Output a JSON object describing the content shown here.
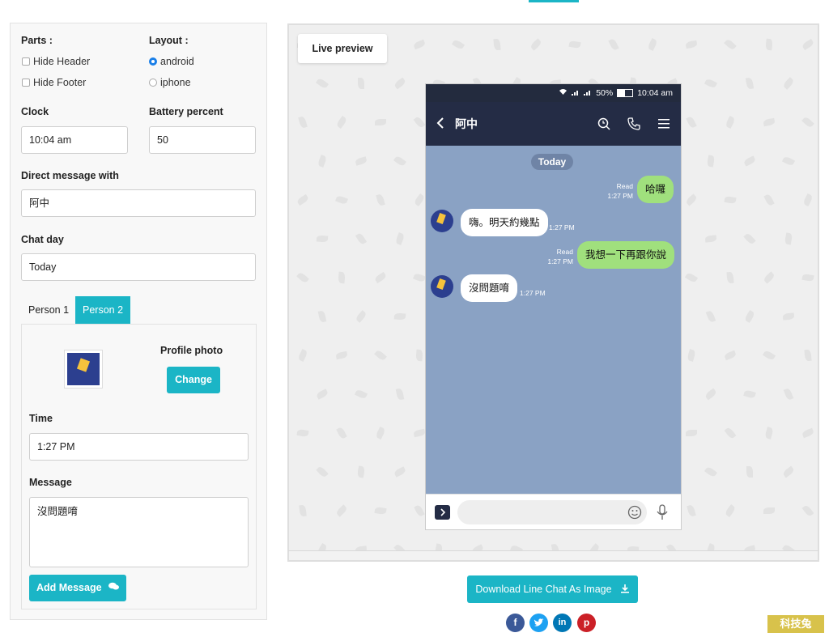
{
  "colors": {
    "accent": "#1bb5c6",
    "chat_bg": "#8aa2c4",
    "my_bubble": "#a0e07d",
    "appbar": "#242c45"
  },
  "settings": {
    "parts_label": "Parts :",
    "hide_header": "Hide Header",
    "hide_footer": "Hide Footer",
    "layout_label": "Layout :",
    "android": "android",
    "iphone": "iphone",
    "clock_label": "Clock",
    "clock_value": "10:04 am",
    "battery_label": "Battery percent",
    "battery_value": "50",
    "dm_label": "Direct message with",
    "dm_value": "阿中",
    "chatday_label": "Chat day",
    "chatday_value": "Today",
    "tabs": [
      "Person 1",
      "Person 2"
    ],
    "profile_photo_label": "Profile photo",
    "change_btn": "Change",
    "time_label": "Time",
    "time_value": "1:27 PM",
    "message_label": "Message",
    "message_value": "沒問題唷",
    "add_message_btn": "Add Message"
  },
  "preview": {
    "tab_label": "Live preview",
    "status": {
      "battery": "50%",
      "time": "10:04 am"
    },
    "contact": "阿中",
    "day": "Today",
    "messages": [
      {
        "side": "me",
        "text": "哈囉",
        "read": "Read",
        "time": "1:27 PM"
      },
      {
        "side": "them",
        "text": "嗨。明天約幾點",
        "time": "1:27 PM"
      },
      {
        "side": "me",
        "text": "我想一下再跟你說",
        "read": "Read",
        "time": "1:27 PM"
      },
      {
        "side": "them",
        "text": "沒問題唷",
        "time": "1:27 PM"
      }
    ]
  },
  "download_btn": "Download Line Chat As Image",
  "social": [
    "facebook",
    "twitter",
    "linkedin",
    "pinterest"
  ],
  "watermark": "科技兔"
}
